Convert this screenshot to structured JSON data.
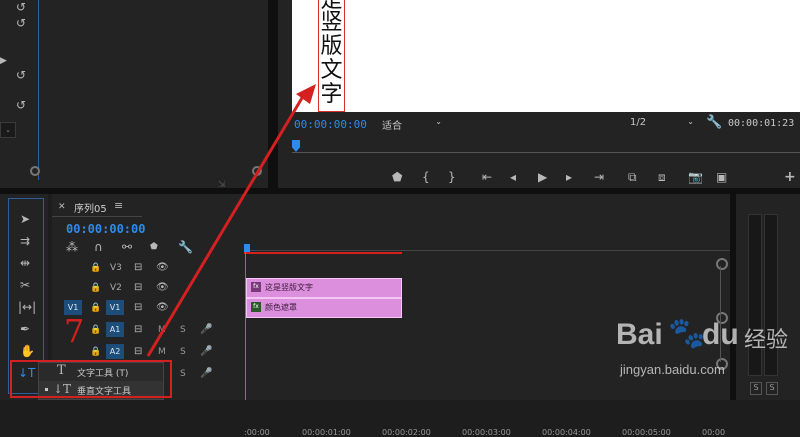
{
  "preview": {
    "vertical_text_chars": [
      "是",
      "竖",
      "版",
      "文",
      "字"
    ],
    "timecode_left": "00:00:00:00",
    "fit_dropdown": "适合",
    "resolution_dropdown": "1/2",
    "timecode_right": "00:00:01:23"
  },
  "timeline": {
    "sequence_title": "序列05",
    "timecode": "00:00:00:00",
    "ruler_ticks": [
      ":00:00",
      "00:00:01:00",
      "00:00:02:00",
      "00:00:03:00",
      "00:00:04:00",
      "00:00:05:00",
      "00:00"
    ],
    "tracks": {
      "v3": "V3",
      "v2": "V2",
      "v1": "V1",
      "a1": "A1",
      "a2": "A2",
      "source_v1": "V1"
    },
    "m_label": "M",
    "s_label": "S",
    "clips": {
      "text_clip": "这是竖版文字",
      "color_matte": "颜色遮罩"
    }
  },
  "annotation": {
    "step_number": "7"
  },
  "tool_flyout": {
    "item1": {
      "label": "文字工具 (T)"
    },
    "item2": {
      "label": "垂直文字工具"
    }
  },
  "audio_meter": {
    "s_label_1": "S",
    "s_label_2": "S"
  },
  "watermark": {
    "logo_text": "Bai",
    "logo_text_2": "du",
    "brand": "经验",
    "url": "jingyan.baidu.com"
  },
  "colors": {
    "accent_blue": "#2d8ceb",
    "clip_pink": "#dc8fdc",
    "annotation_red": "#d42020"
  }
}
